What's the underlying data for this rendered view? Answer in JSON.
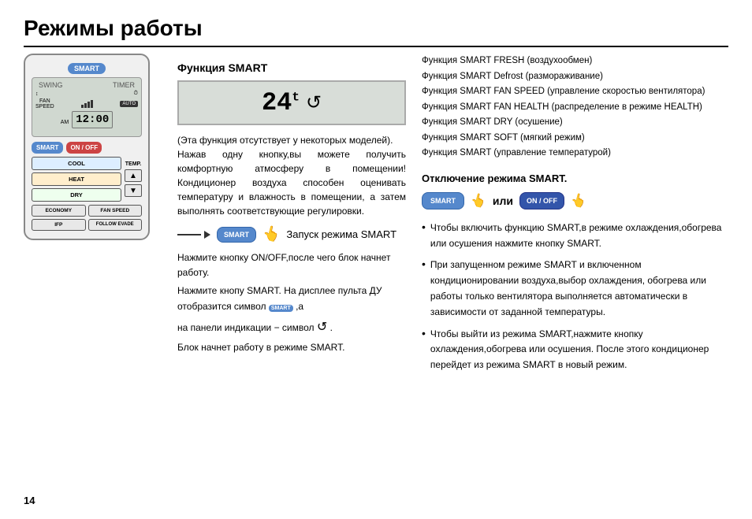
{
  "page": {
    "title": "Режимы работы",
    "page_number": "14"
  },
  "sections": {
    "smart_function": {
      "title": "Функция SMART",
      "display": {
        "temp": "24",
        "degree_symbol": "t",
        "mode_symbol": "↺"
      },
      "intro_text": "(Эта функция отсутствует у некоторых моделей).\nНажав одну кнопку,вы можете получить комфортную атмосферу в помещении! Кондиционер воздуха способен оценивать температуру и  влажность в помещении, а затем выполнять соответствующие регулировки.",
      "smart_launch_label": "SMART",
      "smart_launch_text": "Запуск режима SMART",
      "steps": {
        "line1": "Нажмите кнопку ON/OFF,после чего блок начнет работу.",
        "line2": "Нажмите кнопу SMART. На дисплее пульта ДУ отобразится символ",
        "smart_symbol": "SMART",
        "line3": ",а",
        "line4": "на панели  индикации  − символ",
        "symbol2": "↺",
        "line5": " .",
        "line6": "Блок начнет работу в режиме SMART."
      }
    },
    "features": {
      "items": [
        "Функция SMART FRESH  (воздухообмен)",
        "Функция SMART Defrost (размораживание)",
        "Функция SMART FAN SPEED (управление скоростью вентилятора)",
        "Функция SMART FAN HEALTH (распределение в режиме HEALTH)",
        "Функция SMART DRY (осушение)",
        "Функция SMART SOFT (мягкий режим)",
        "Функция SMART (управление температурой)"
      ]
    },
    "smart_off": {
      "title": "Отключение режима SMART.",
      "smart_btn": "SMART",
      "ili": "или",
      "onoff_btn": "ON / OFF",
      "bullets": [
        "Чтобы включить функцию SMART,в режиме охлаждения,обогрева или  осушения нажмите кнопку SMART.",
        "При  запущенном режиме SMART и  включенном кондиционировании  воздуха,выбор охлаждения, обогрева или  работы только вентилятора выполняется автоматически  в зависимости  от заданной температуры.",
        "Чтобы выйти  из режима SMART,нажмите кнопку охлаждения,обогрева или  осушения. После этого кондиционер перейдет из режима SMART в новый режим."
      ]
    }
  },
  "remote": {
    "smart_top": "SMART",
    "time": "12:00",
    "smart_bottom": "SMART",
    "onoff": "ON / OFF",
    "modes": {
      "cool": "COOL",
      "heat": "HEAT",
      "dry": "DRY",
      "temp": "TEMP."
    },
    "bottom_btns": {
      "economy": "ECONOMY",
      "fan_speed": "FAN SPEED",
      "ifp": "IFP",
      "follow_evade": "FOLLOW EVADE"
    }
  }
}
